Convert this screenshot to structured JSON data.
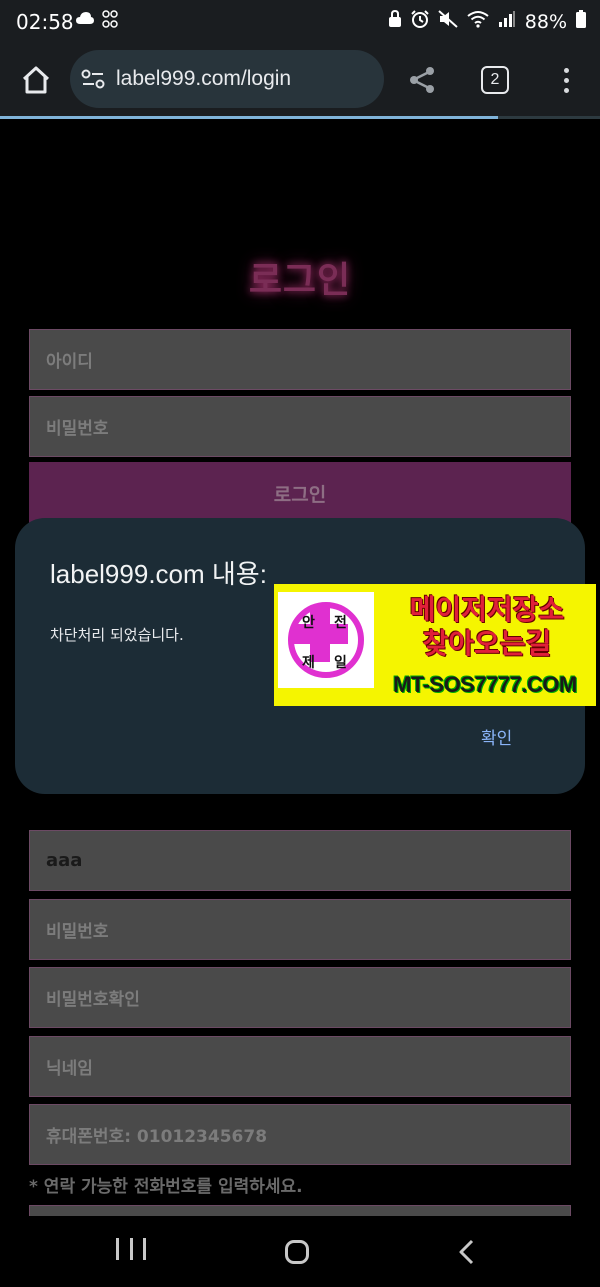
{
  "status_bar": {
    "time": "02:58",
    "battery": "88%",
    "icons": [
      "cloud-icon",
      "pinwheel-icon",
      "lock-icon",
      "alarm-icon",
      "mute-icon",
      "wifi-icon",
      "signal-icon",
      "battery-icon"
    ]
  },
  "browser": {
    "url": "label999.com/login",
    "tab_count": "2"
  },
  "page": {
    "login_title": "로그인",
    "id_placeholder": "아이디",
    "password_placeholder": "비밀번호",
    "login_button": "로그인",
    "signup": {
      "id_value": "aaa",
      "password_placeholder": "비밀번호",
      "password_confirm_placeholder": "비밀번호확인",
      "nickname_placeholder": "닉네임",
      "phone_placeholder": "휴대폰번호: 01012345678",
      "phone_notice": "* 연락 가능한 전화번호를 입력하세요."
    }
  },
  "dialog": {
    "title": "label999.com 내용:",
    "message": "차단처리 되었습니다.",
    "ok_label": "확인"
  },
  "ad": {
    "logo_chars": [
      "안",
      "전",
      "제",
      "일"
    ],
    "line1": "메이저저장소",
    "line2": "찾아오는길",
    "line3": "MT-SOS7777.COM"
  },
  "colors": {
    "accent_pink": "#e030d0",
    "dialog_bg": "#1c2c36",
    "ok_blue": "#8ab4f8",
    "ad_yellow": "#f5f500"
  },
  "load_progress": 0.83
}
